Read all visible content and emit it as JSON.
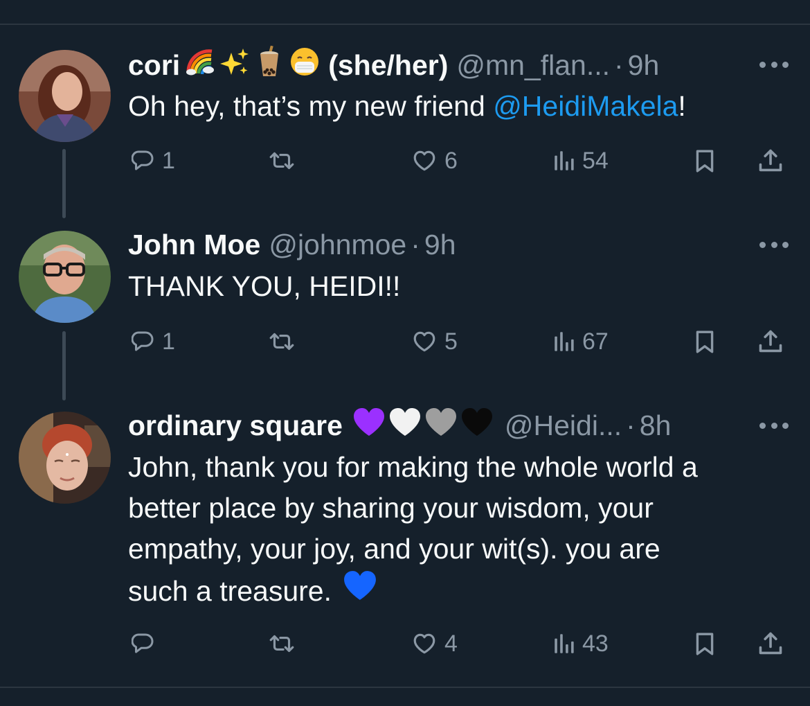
{
  "tweets": [
    {
      "name": "cori",
      "name_emoji": [
        "rainbow-emoji",
        "sparkles-emoji",
        "bubble-tea-emoji",
        "mask-face-emoji"
      ],
      "pronouns": "(she/her)",
      "handle": "@mn_flan...",
      "dot": "·",
      "time": "9h",
      "text_before": "Oh hey, that’s my new friend ",
      "mention": "@HeidiMakela",
      "text_after": "!",
      "replies": "1",
      "retweets": "",
      "likes": "6",
      "views": "54"
    },
    {
      "name": "John Moe",
      "handle": "@johnmoe",
      "dot": "·",
      "time": "9h",
      "text": "THANK YOU, HEIDI!!",
      "replies": "1",
      "retweets": "",
      "likes": "5",
      "views": "67"
    },
    {
      "name": "ordinary square",
      "name_emoji": [
        "purple-heart-emoji",
        "white-heart-emoji",
        "grey-heart-emoji",
        "black-heart-emoji"
      ],
      "handle": "@Heidi...",
      "dot": "·",
      "time": "8h",
      "lines": [
        "John, thank you for making the whole world a",
        "better place by sharing your wisdom, your",
        "empathy, your joy, and your wit(s). you are",
        "such a treasure."
      ],
      "trailing_emoji": "blue-heart-emoji",
      "replies": "",
      "retweets": "",
      "likes": "4",
      "views": "43"
    }
  ],
  "colors": {
    "background": "#15202b",
    "text": "#f7f9f9",
    "muted": "#8b98a5",
    "mention": "#1d9bf0",
    "divider": "#2c3640",
    "thread_line": "#3d4a56"
  }
}
